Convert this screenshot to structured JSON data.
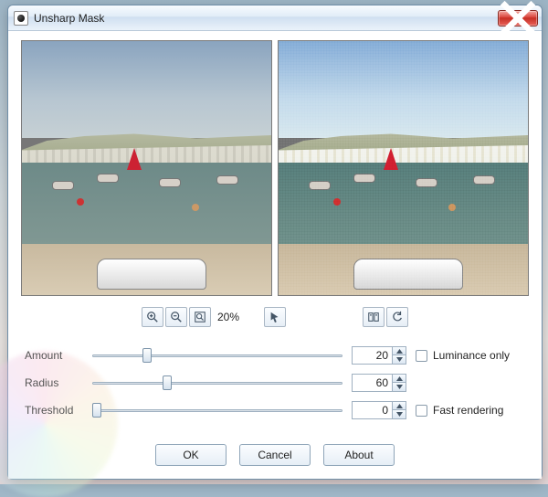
{
  "window": {
    "title": "Unsharp Mask"
  },
  "toolbar": {
    "zoom_text": "20%",
    "icons": {
      "zoom_in": "zoom-in-icon",
      "zoom_out": "zoom-out-icon",
      "zoom_fit": "zoom-fit-icon",
      "pointer": "pointer-icon",
      "compare": "compare-icon",
      "reset": "reset-icon"
    }
  },
  "sliders": {
    "amount": {
      "label": "Amount",
      "value": "20",
      "pos_pct": 22
    },
    "radius": {
      "label": "Radius",
      "value": "60",
      "pos_pct": 30
    },
    "threshold": {
      "label": "Threshold",
      "value": "0",
      "pos_pct": 2
    }
  },
  "checks": {
    "luminance": {
      "label": "Luminance only",
      "checked": false
    },
    "fast": {
      "label": "Fast rendering",
      "checked": false
    }
  },
  "buttons": {
    "ok": "OK",
    "cancel": "Cancel",
    "about": "About"
  }
}
